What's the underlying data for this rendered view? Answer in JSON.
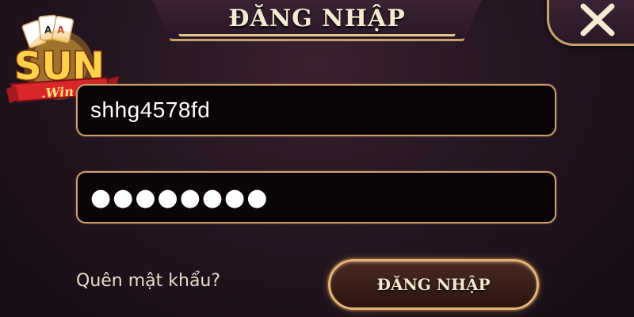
{
  "dialog": {
    "title": "ĐĂNG NHẬP",
    "close_icon": "close-icon"
  },
  "logo": {
    "brand_top": "SUN",
    "brand_bottom": ".Win"
  },
  "form": {
    "username_value": "shhg4578fd",
    "password_mask": "●●●●●●●●",
    "forgot_password_label": "Quên mật khẩu?",
    "submit_label": "ĐĂNG NHẬP"
  },
  "colors": {
    "gold_border": "#c9a46a",
    "background": "#241521",
    "field_bg": "#0c0507",
    "text": "#f5ead2"
  }
}
